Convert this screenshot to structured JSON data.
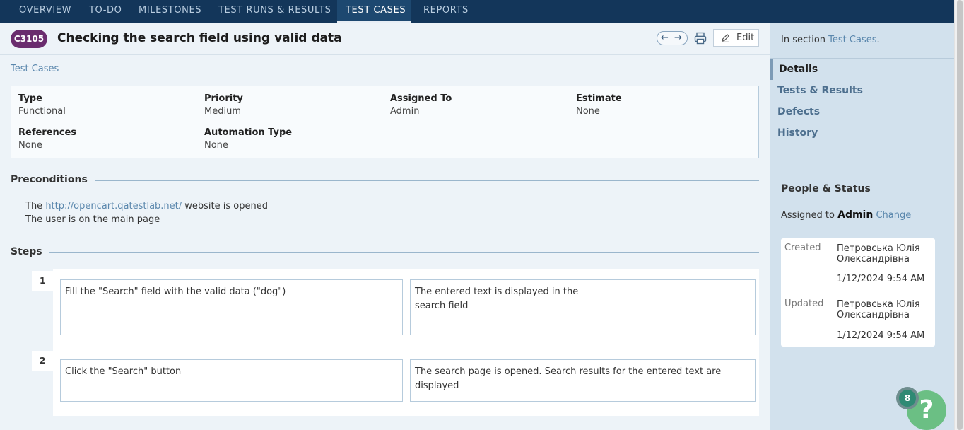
{
  "topnav": {
    "tabs": [
      {
        "label": "OVERVIEW"
      },
      {
        "label": "TO-DO"
      },
      {
        "label": "MILESTONES"
      },
      {
        "label": "TEST RUNS & RESULTS"
      },
      {
        "label": "TEST CASES"
      },
      {
        "label": "REPORTS"
      }
    ],
    "active": "TEST CASES"
  },
  "case": {
    "id": "C3105",
    "title": "Checking the search field using valid data",
    "edit_label": "Edit",
    "section_link": "Test Cases"
  },
  "fields": {
    "type": {
      "label": "Type",
      "value": "Functional"
    },
    "priority": {
      "label": "Priority",
      "value": "Medium"
    },
    "assigned_to": {
      "label": "Assigned To",
      "value": "Admin"
    },
    "estimate": {
      "label": "Estimate",
      "value": "None"
    },
    "references": {
      "label": "References",
      "value": "None"
    },
    "automation_type": {
      "label": "Automation Type",
      "value": "None"
    }
  },
  "preconditions": {
    "heading": "Preconditions",
    "line1_prefix": "The ",
    "line1_link": "http://opencart.qatestlab.net/",
    "line1_suffix": " website is opened",
    "line2": "The user is on the main page"
  },
  "steps": {
    "heading": "Steps",
    "items": [
      {
        "num": "1",
        "action": "Fill the \"Search\" field with the valid data (\"dog\")",
        "expected_line1": "The entered text is displayed in the",
        "expected_line2": "search field"
      },
      {
        "num": "2",
        "action": "Click the \"Search\" button",
        "expected": "The search page is opened. Search results for the entered text are displayed"
      }
    ]
  },
  "sidebar": {
    "section_prefix": "In section ",
    "section_link": "Test Cases",
    "section_suffix": ".",
    "tabs": [
      {
        "label": "Details"
      },
      {
        "label": "Tests & Results"
      },
      {
        "label": "Defects"
      },
      {
        "label": "History"
      }
    ],
    "active_tab": "Details",
    "people_heading": "People & Status",
    "assigned_prefix": "Assigned to ",
    "assigned_user": "Admin",
    "change_link": "Change",
    "created_label": "Created",
    "created_by_line1": "Петровська Юлія",
    "created_by_line2": "Олександрівна",
    "created_at": "1/12/2024 9:54 AM",
    "updated_label": "Updated",
    "updated_by_line1": "Петровська Юлія",
    "updated_by_line2": "Олександрівна",
    "updated_at": "1/12/2024 9:54 AM"
  },
  "help": {
    "badge_count": "8",
    "symbol": "?"
  },
  "colors": {
    "nav_bg": "#13365a",
    "badge_bg": "#6a2c6e",
    "link": "#5a87ad",
    "help_bg": "#6bbf84"
  },
  "icons": [
    "arrow-left-icon",
    "arrow-right-icon",
    "print-icon",
    "pencil-icon",
    "question-icon"
  ]
}
